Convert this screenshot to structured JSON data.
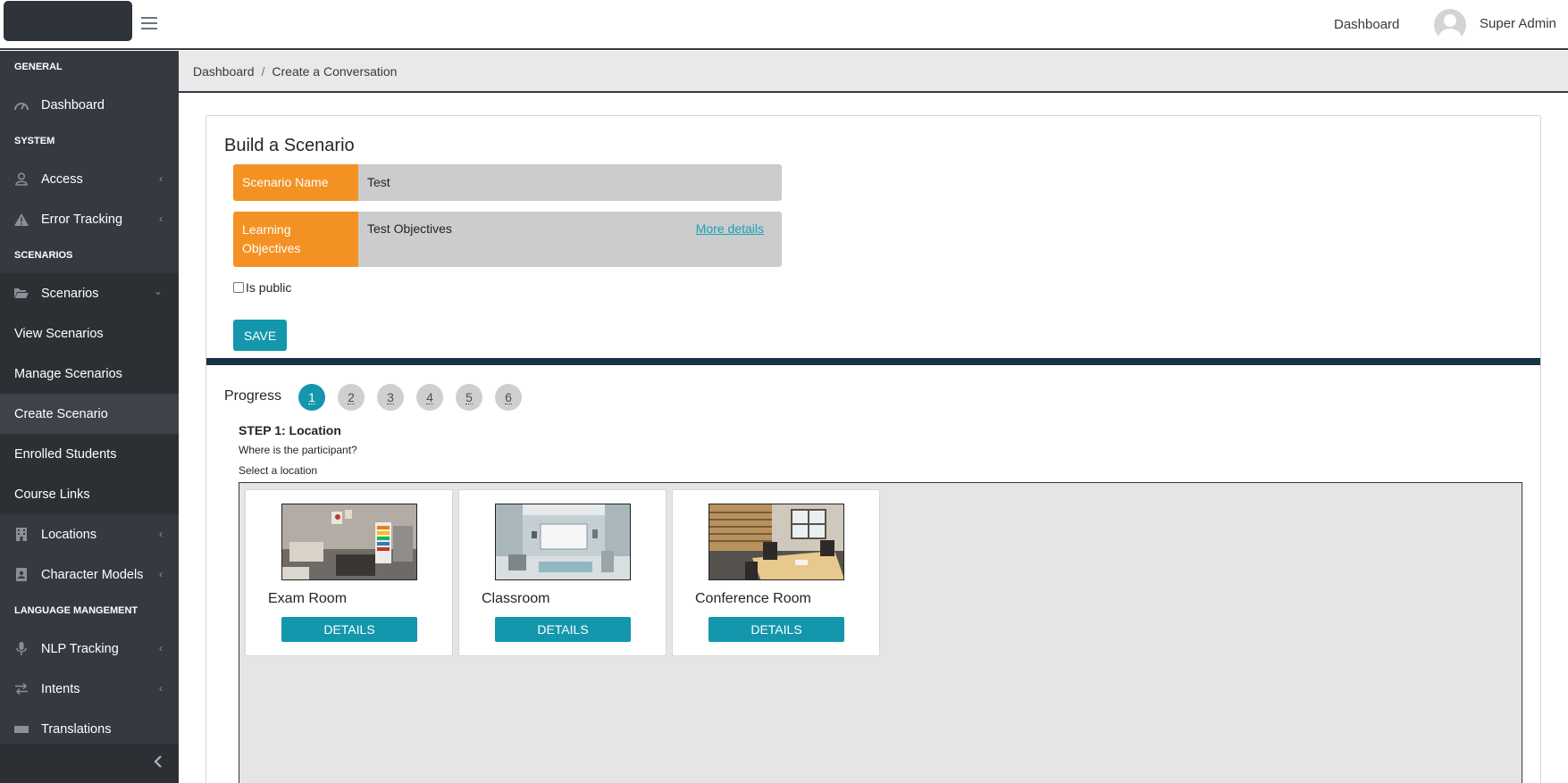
{
  "header": {
    "dashboard_link": "Dashboard",
    "user_name": "Super Admin"
  },
  "sidebar": {
    "sections": {
      "general": "GENERAL",
      "system": "SYSTEM",
      "scenarios": "SCENARIOS",
      "language": "LANGUAGE MANGEMENT"
    },
    "items": {
      "dashboard": "Dashboard",
      "access": "Access",
      "error_tracking": "Error Tracking",
      "scenarios": "Scenarios",
      "view_scenarios": "View Scenarios",
      "manage_scenarios": "Manage Scenarios",
      "create_scenario": "Create Scenario",
      "enrolled_students": "Enrolled Students",
      "course_links": "Course Links",
      "locations": "Locations",
      "character_models": "Character Models",
      "nlp_tracking": "NLP Tracking",
      "intents": "Intents",
      "partial": "Translations"
    }
  },
  "breadcrumb": {
    "home": "Dashboard",
    "separator": "/",
    "current": "Create a Conversation"
  },
  "form": {
    "title": "Build a Scenario",
    "scenario_name_label": "Scenario Name",
    "scenario_name_value": "Test",
    "objectives_label": "Learning Objectives",
    "objectives_value": "Test Objectives",
    "more_details": "More details",
    "is_public_label": "Is public",
    "is_public_checked": false,
    "save_label": "SAVE"
  },
  "progress": {
    "label": "Progress",
    "steps": [
      "1",
      "2",
      "3",
      "4",
      "5",
      "6"
    ],
    "active_step": 1
  },
  "step": {
    "title": "STEP 1: Location",
    "question": "Where is the participant?",
    "select_label": "Select a location"
  },
  "locations": [
    {
      "name": "Exam Room",
      "button": "DETAILS"
    },
    {
      "name": "Classroom",
      "button": "DETAILS"
    },
    {
      "name": "Conference Room",
      "button": "DETAILS"
    }
  ],
  "colors": {
    "sidebar_bg": "#343a40",
    "accent_orange": "#f39223",
    "accent_teal": "#1496ad",
    "divider_navy": "#163443"
  }
}
